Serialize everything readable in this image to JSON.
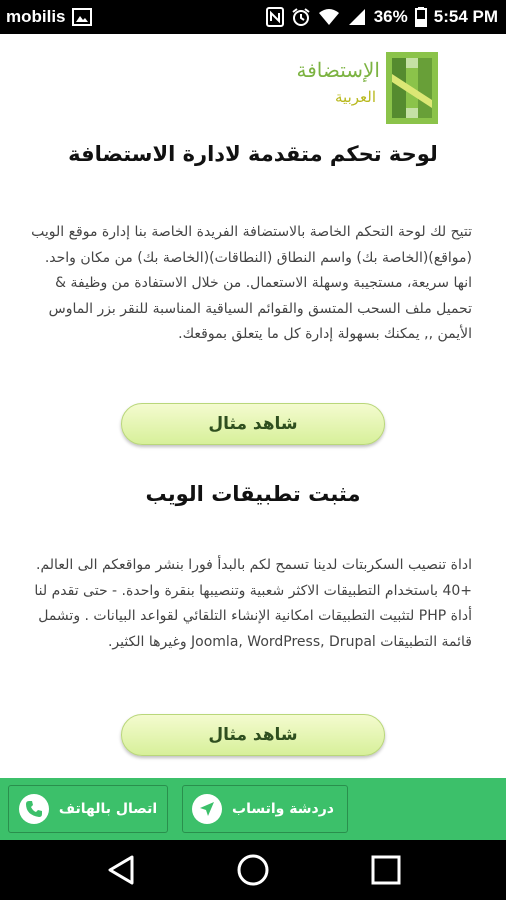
{
  "status_bar": {
    "carrier": "mobilis",
    "battery": "36%",
    "time": "5:54 PM",
    "icons": [
      "image-icon",
      "nfc-icon",
      "alarm-icon",
      "wifi-icon",
      "signal-icon",
      "battery-icon"
    ]
  },
  "logo": {
    "line1": "الإستضافة",
    "line2": "العربية",
    "colors": {
      "primary": "#7cb342",
      "secondary": "#b8b81c"
    }
  },
  "section1": {
    "title": "لوحة تحكم متقدمة لادارة الاستضافة",
    "body": "تتيح لك لوحة التحكم الخاصة بالاستضافة الفريدة الخاصة بنا إدارة موقع الويب (مواقع)(الخاصة بك) واسم النطاق (النطاقات)(الخاصة بك) من مكان واحد. انها سريعة، مستجيبة وسهلة الاستعمال. من خلال الاستفادة من وظيفة & تحميل ملف السحب المتسق والقوائم السياقية المناسبة للنقر بزر الماوس الأيمن ,, يمكنك بسهولة إدارة كل ما يتعلق بموقعك.",
    "button": "شاهد مثال"
  },
  "section2": {
    "title": "مثبت تطبيقات الويب",
    "body": "اداة تنصيب السكربتات لدينا تسمح لكم بالبدأ فورا بنشر مواقعكم الى العالم. +40 باستخدام التطبيقات الاكثر شعبية وتنصيبها بنقرة واحدة. - حتى تقدم لنا أداة PHP لتثبيت التطبيقات امكانية الإنشاء التلقائي لقواعد البيانات . وتشمل قائمة التطبيقات Joomla, WordPress, Drupal وغيرها الكثير.",
    "button": "شاهد مثال"
  },
  "bottom_bar": {
    "call_label": "اتصال بالهاتف",
    "whatsapp_label": "دردشة واتساب",
    "color": "#3cc06a"
  },
  "nav_bar": {
    "buttons": [
      "back-icon",
      "home-icon",
      "recent-apps-icon"
    ]
  }
}
